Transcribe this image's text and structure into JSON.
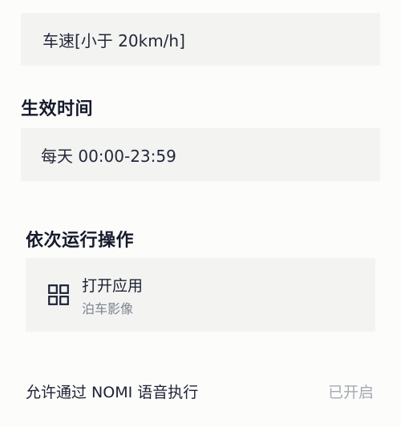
{
  "trigger": {
    "speed_condition": "车速[小于 20km/h]"
  },
  "effective_time": {
    "title": "生效时间",
    "value": "每天 00:00-23:59"
  },
  "actions": {
    "title": "依次运行操作",
    "items": [
      {
        "icon": "grid-apps-icon",
        "title": "打开应用",
        "subtitle": "泊车影像"
      }
    ]
  },
  "nomi": {
    "label": "允许通过 NOMI 语音执行",
    "status": "已开启"
  }
}
